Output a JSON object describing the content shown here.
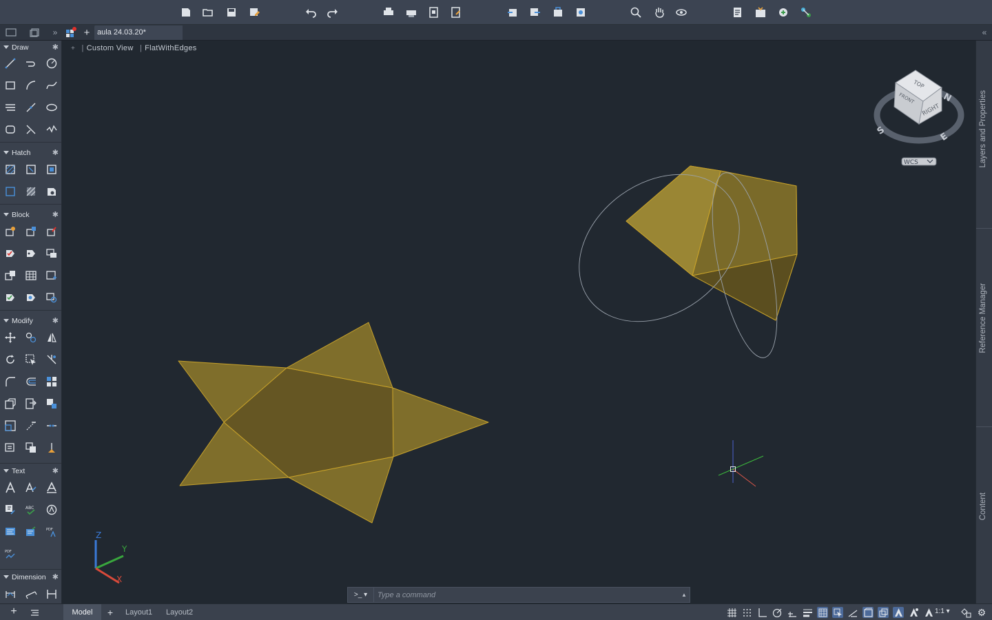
{
  "document": {
    "tab_title": "aula 24.03.20*"
  },
  "viewport": {
    "view_minus": "+",
    "view_name": "Custom View",
    "visual_style": "FlatWithEdges"
  },
  "viewcube": {
    "face_top": "TOP",
    "face_right": "RIGHT",
    "face_front": "FRONT",
    "compass_n": "N",
    "compass_s": "S",
    "compass_e": "E",
    "ucs_menu": "WCS"
  },
  "ucs_icon": {
    "x_label": "X",
    "y_label": "Y",
    "z_label": "Z"
  },
  "palette": {
    "sections": [
      {
        "key": "draw",
        "label": "Draw"
      },
      {
        "key": "hatch",
        "label": "Hatch"
      },
      {
        "key": "block",
        "label": "Block"
      },
      {
        "key": "modify",
        "label": "Modify"
      },
      {
        "key": "text",
        "label": "Text"
      },
      {
        "key": "dimension",
        "label": "Dimension"
      }
    ]
  },
  "right_panels": {
    "layers": "Layers and Properties",
    "reference": "Reference Manager",
    "content": "Content"
  },
  "command_line": {
    "prompt_glyph": ">_ ▾",
    "placeholder": "Type a command",
    "history_toggle": "▲"
  },
  "layout_tabs": {
    "model": "Model",
    "add": "+",
    "layout1": "Layout1",
    "layout2": "Layout2"
  },
  "status": {
    "annotation_scale": "1:1 ▾"
  },
  "colors": {
    "background": "#212830",
    "solid_face": "#8a7a2c",
    "solid_edge": "#c9a32a",
    "accent": "#4c6a9a"
  }
}
